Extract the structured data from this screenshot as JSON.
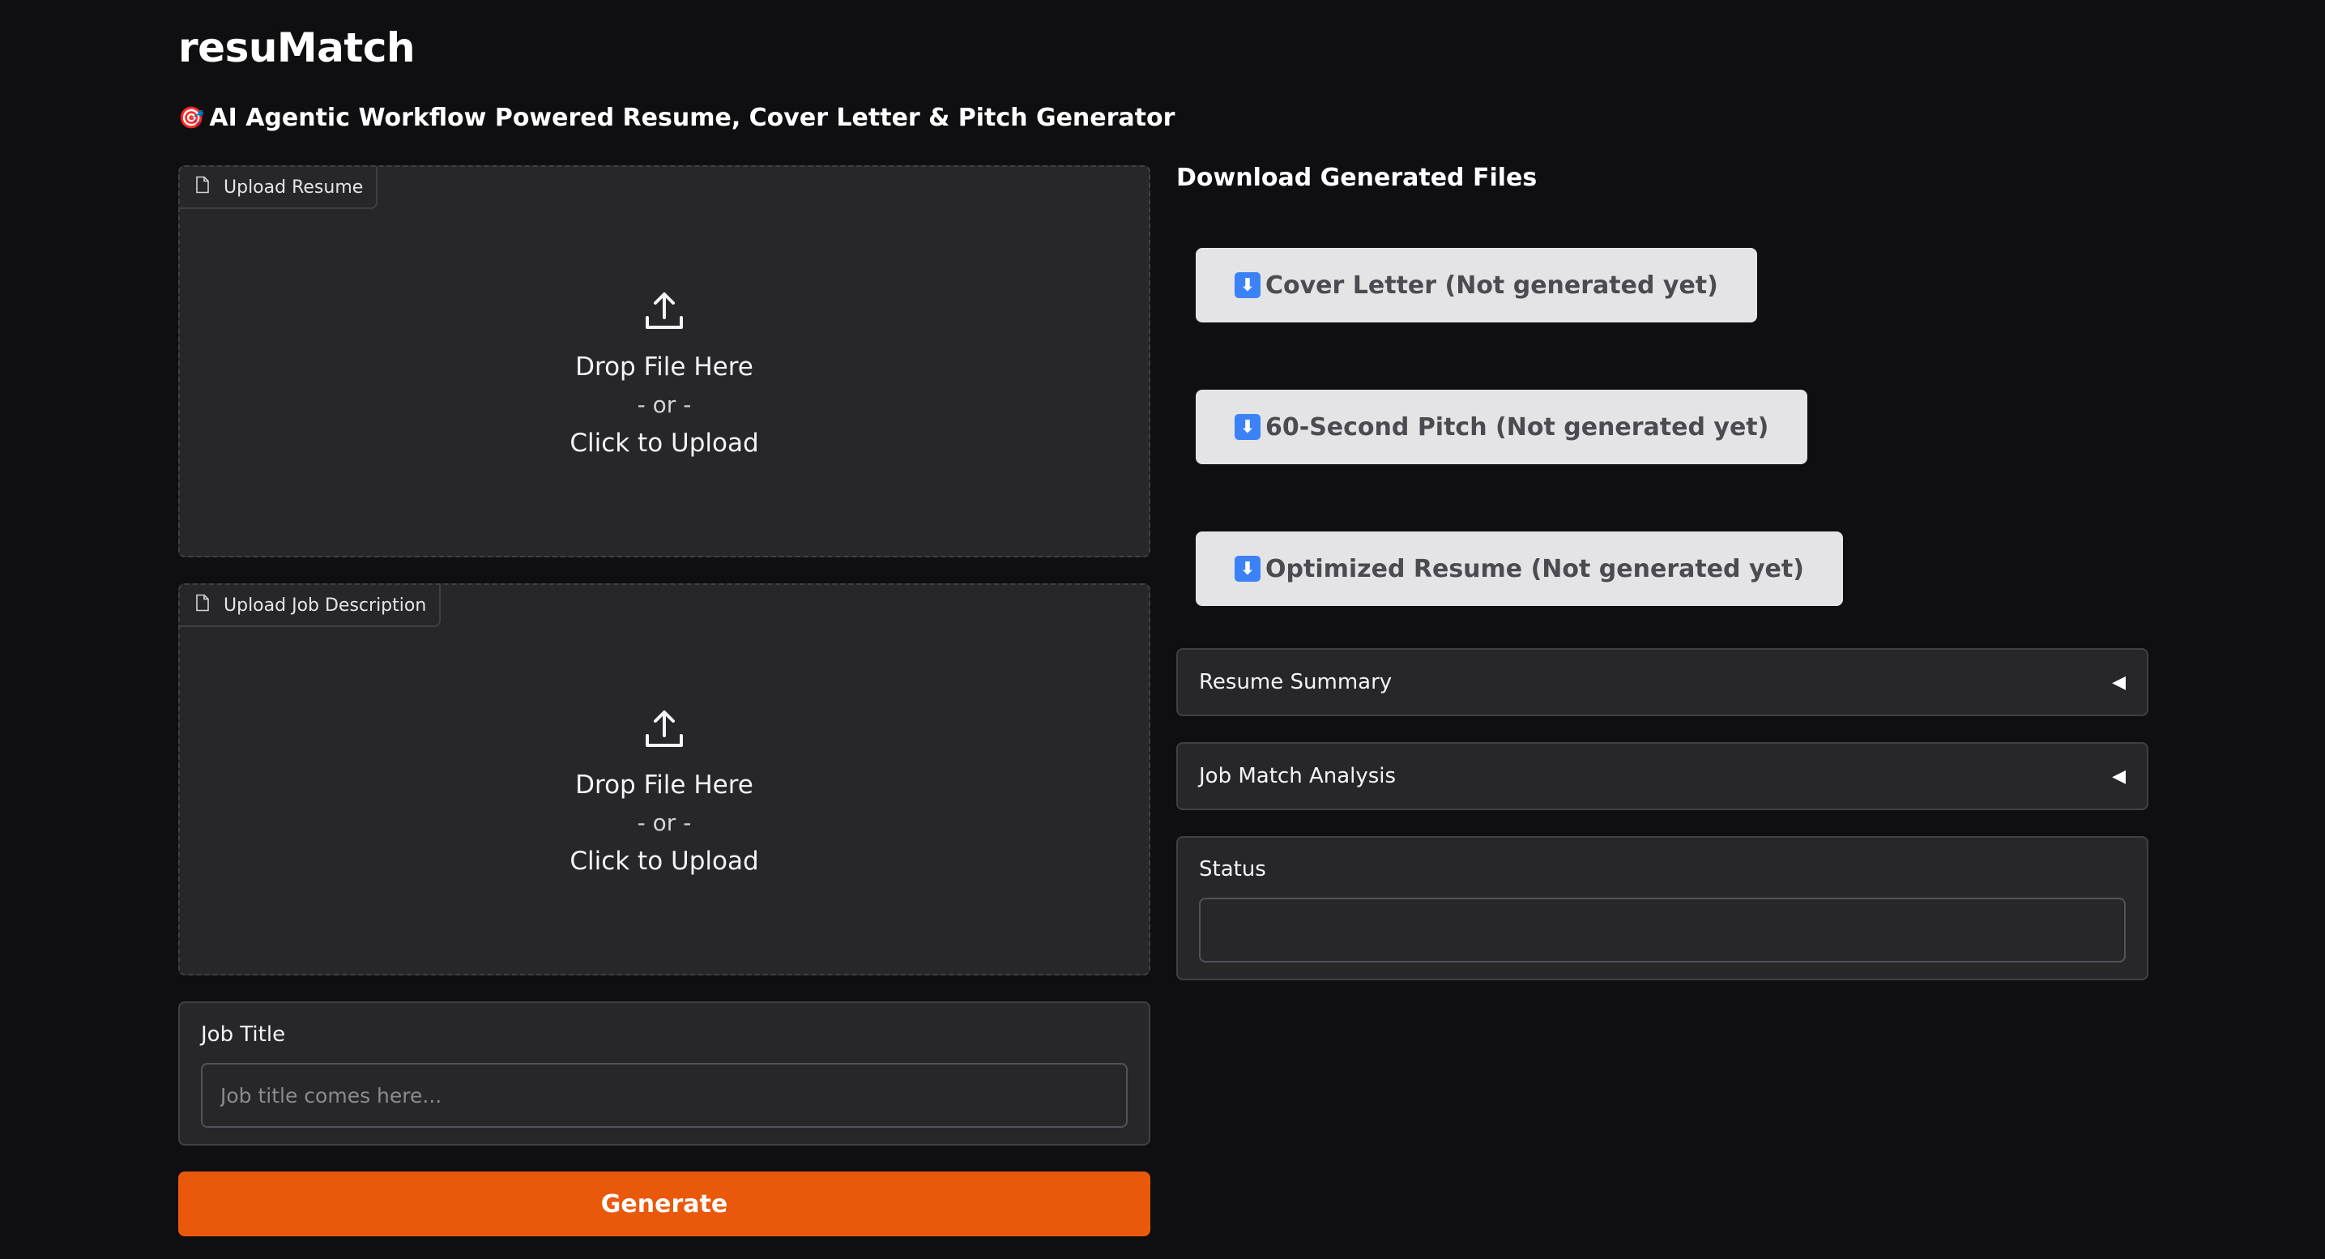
{
  "app": {
    "title": "resuMatch",
    "subtitle_emoji": "🎯",
    "subtitle": "AI Agentic Workflow Powered Resume, Cover Letter & Pitch Generator"
  },
  "uploads": [
    {
      "label": "Upload Resume",
      "drop_text": "Drop File Here",
      "or_text": "- or -",
      "click_text": "Click to Upload",
      "file_icon": "file-icon",
      "upload_icon": "upload-icon"
    },
    {
      "label": "Upload Job Description",
      "drop_text": "Drop File Here",
      "or_text": "- or -",
      "click_text": "Click to Upload",
      "file_icon": "file-icon",
      "upload_icon": "upload-icon"
    }
  ],
  "job_title": {
    "label": "Job Title",
    "placeholder": "Job title comes here...",
    "value": ""
  },
  "generate": {
    "label": "Generate"
  },
  "downloads": {
    "heading": "Download Generated Files",
    "icon": "⬇️",
    "buttons": [
      {
        "label": "Cover Letter (Not generated yet)"
      },
      {
        "label": "60-Second Pitch (Not generated yet)"
      },
      {
        "label": "Optimized Resume (Not generated yet)"
      }
    ]
  },
  "accordions": [
    {
      "label": "Resume Summary",
      "caret": "◀"
    },
    {
      "label": "Job Match Analysis",
      "caret": "◀"
    }
  ],
  "status": {
    "label": "Status",
    "value": ""
  },
  "colors": {
    "background": "#0f0f11",
    "panel": "#27272a",
    "border": "#3f3f46",
    "accent": "#ea580c",
    "download_button": "#e4e4e7"
  }
}
